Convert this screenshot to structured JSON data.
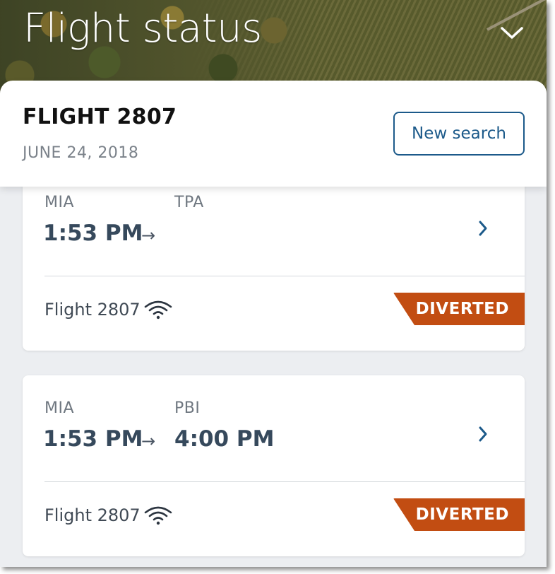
{
  "header": {
    "title": "Flight status"
  },
  "summary": {
    "flight": "FLIGHT 2807",
    "date": "JUNE 24, 2018",
    "new_search_label": "New search"
  },
  "cards": [
    {
      "origin": "MIA",
      "destination": "TPA",
      "depart_time": "1:53 PM",
      "arrow": "→",
      "arrive_time": "",
      "flight_label": "Flight 2807",
      "status": "DIVERTED"
    },
    {
      "origin": "MIA",
      "destination": "PBI",
      "depart_time": "1:53 PM",
      "arrow": "→",
      "arrive_time": "4:00 PM",
      "flight_label": "Flight 2807",
      "status": "DIVERTED"
    }
  ],
  "colors": {
    "accent": "#1c5a8a",
    "status_diverted": "#c24d12",
    "time_text": "#36495c"
  },
  "icons": {
    "collapse": "chevron-down-icon",
    "details": "chevron-right-icon",
    "wifi": "wifi-icon"
  }
}
